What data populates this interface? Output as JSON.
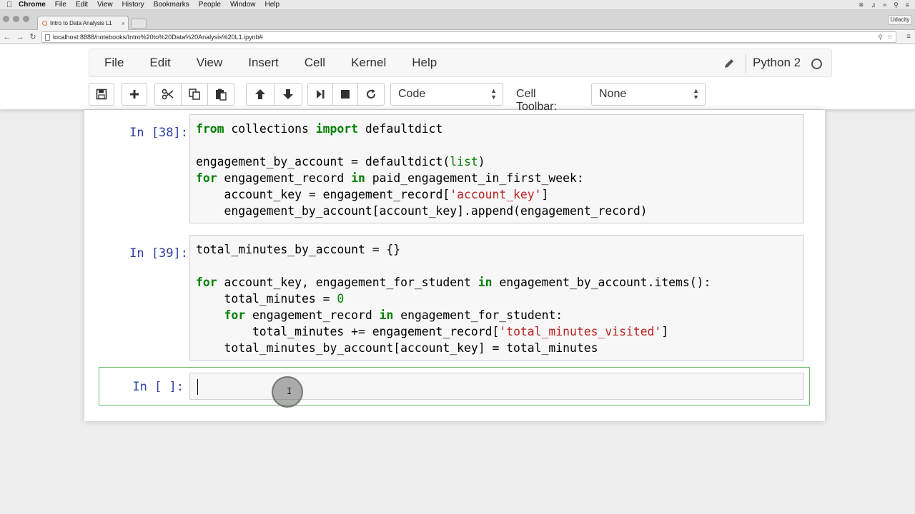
{
  "mac_menu": {
    "app": "Chrome",
    "items": [
      "File",
      "Edit",
      "View",
      "History",
      "Bookmarks",
      "People",
      "Window",
      "Help"
    ]
  },
  "browser": {
    "tab_title": "Intro to Data Analysis L1",
    "url": "localhost:8888/notebooks/Intro%20to%20Data%20Analysis%20L1.ipynb#",
    "profile": "Udacity"
  },
  "jupyter": {
    "menu": [
      "File",
      "Edit",
      "View",
      "Insert",
      "Cell",
      "Kernel",
      "Help"
    ],
    "kernel": "Python 2",
    "cell_type": "Code",
    "cell_toolbar_label": "Cell Toolbar:",
    "cell_toolbar_value": "None"
  },
  "cells": [
    {
      "prompt": "In [38]:"
    },
    {
      "prompt": "In [39]:"
    },
    {
      "prompt": "In [ ]:"
    }
  ],
  "icons": [
    "save-icon",
    "plus-icon",
    "scissors-icon",
    "copy-icon",
    "paste-icon",
    "arrow-up-icon",
    "arrow-down-icon",
    "step-forward-icon",
    "stop-icon",
    "refresh-icon",
    "pencil-icon"
  ]
}
